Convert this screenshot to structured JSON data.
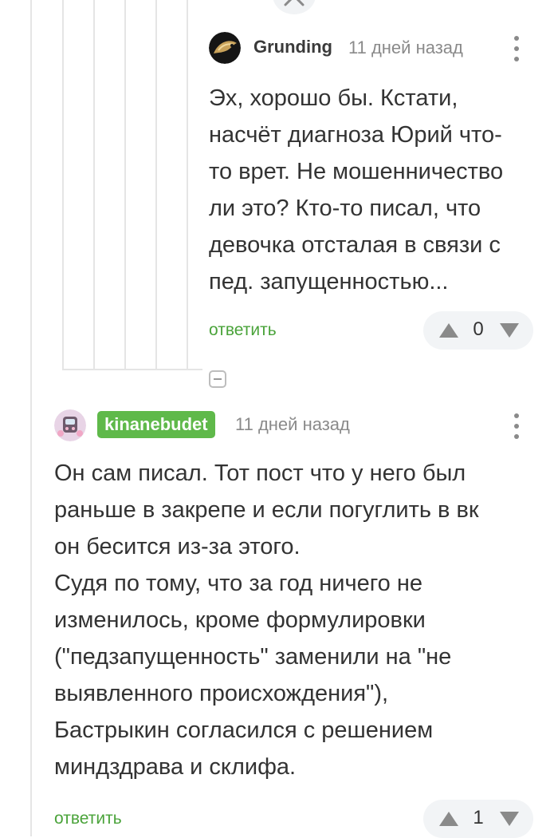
{
  "comments": [
    {
      "username": "Grunding",
      "timestamp": "11 дней назад",
      "text": "Эх, хорошо бы. Кстати,\nнасчёт диагноза Юрий что-\nто врет. Не мошенничество\nли это? Кто-то писал, что\nдевочка отсталая в связи с\nпед. запущенностью...",
      "reply_label": "ответить",
      "rating": "0"
    },
    {
      "username": "kinanebudet",
      "timestamp": "11 дней назад",
      "text": "Он сам писал. Тот пост что у него был\nраньше в закрепе и если погуглить в вк\nон бесится из-за этого.\nСудя по тому, что за год ничего не\nизменилось, кроме формулировки\n(\"педзапущенность\" заменили на \"не\nвыявленного происхождения\"),\nБастрыкин согласился с решением\nминдздрава и склифа.",
      "reply_label": "ответить",
      "rating": "1"
    }
  ],
  "icons": {
    "close": "close-icon",
    "more": "more-vertical-icon",
    "upvote": "triangle-up-icon",
    "downvote": "triangle-down-icon",
    "collapse": "collapse-thread-icon"
  },
  "colors": {
    "accent_green": "#4aa33a",
    "badge_green": "#5fb94a",
    "thread_line": "#e5e5e5",
    "vote_bg": "#f2f4f6"
  }
}
